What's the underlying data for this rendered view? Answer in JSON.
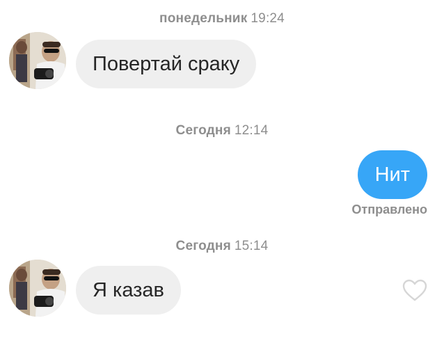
{
  "messages": [
    {
      "type": "timestamp",
      "day": "понедельник",
      "time": "19:24"
    },
    {
      "type": "incoming",
      "text": "Повертай сраку"
    },
    {
      "type": "timestamp",
      "day": "Сегодня",
      "time": "12:14"
    },
    {
      "type": "outgoing",
      "text": "Нит",
      "status": "Отправлено"
    },
    {
      "type": "timestamp",
      "day": "Сегодня",
      "time": "15:14"
    },
    {
      "type": "incoming",
      "text": "Я казав"
    }
  ],
  "icons": {
    "like": "heart-outline-icon",
    "avatar": "user-avatar"
  },
  "colors": {
    "outgoing_bubble": "#37a6f7",
    "incoming_bubble": "#efefef",
    "timestamp_text": "#8e8e8e",
    "like_icon": "#d6d6d6"
  }
}
